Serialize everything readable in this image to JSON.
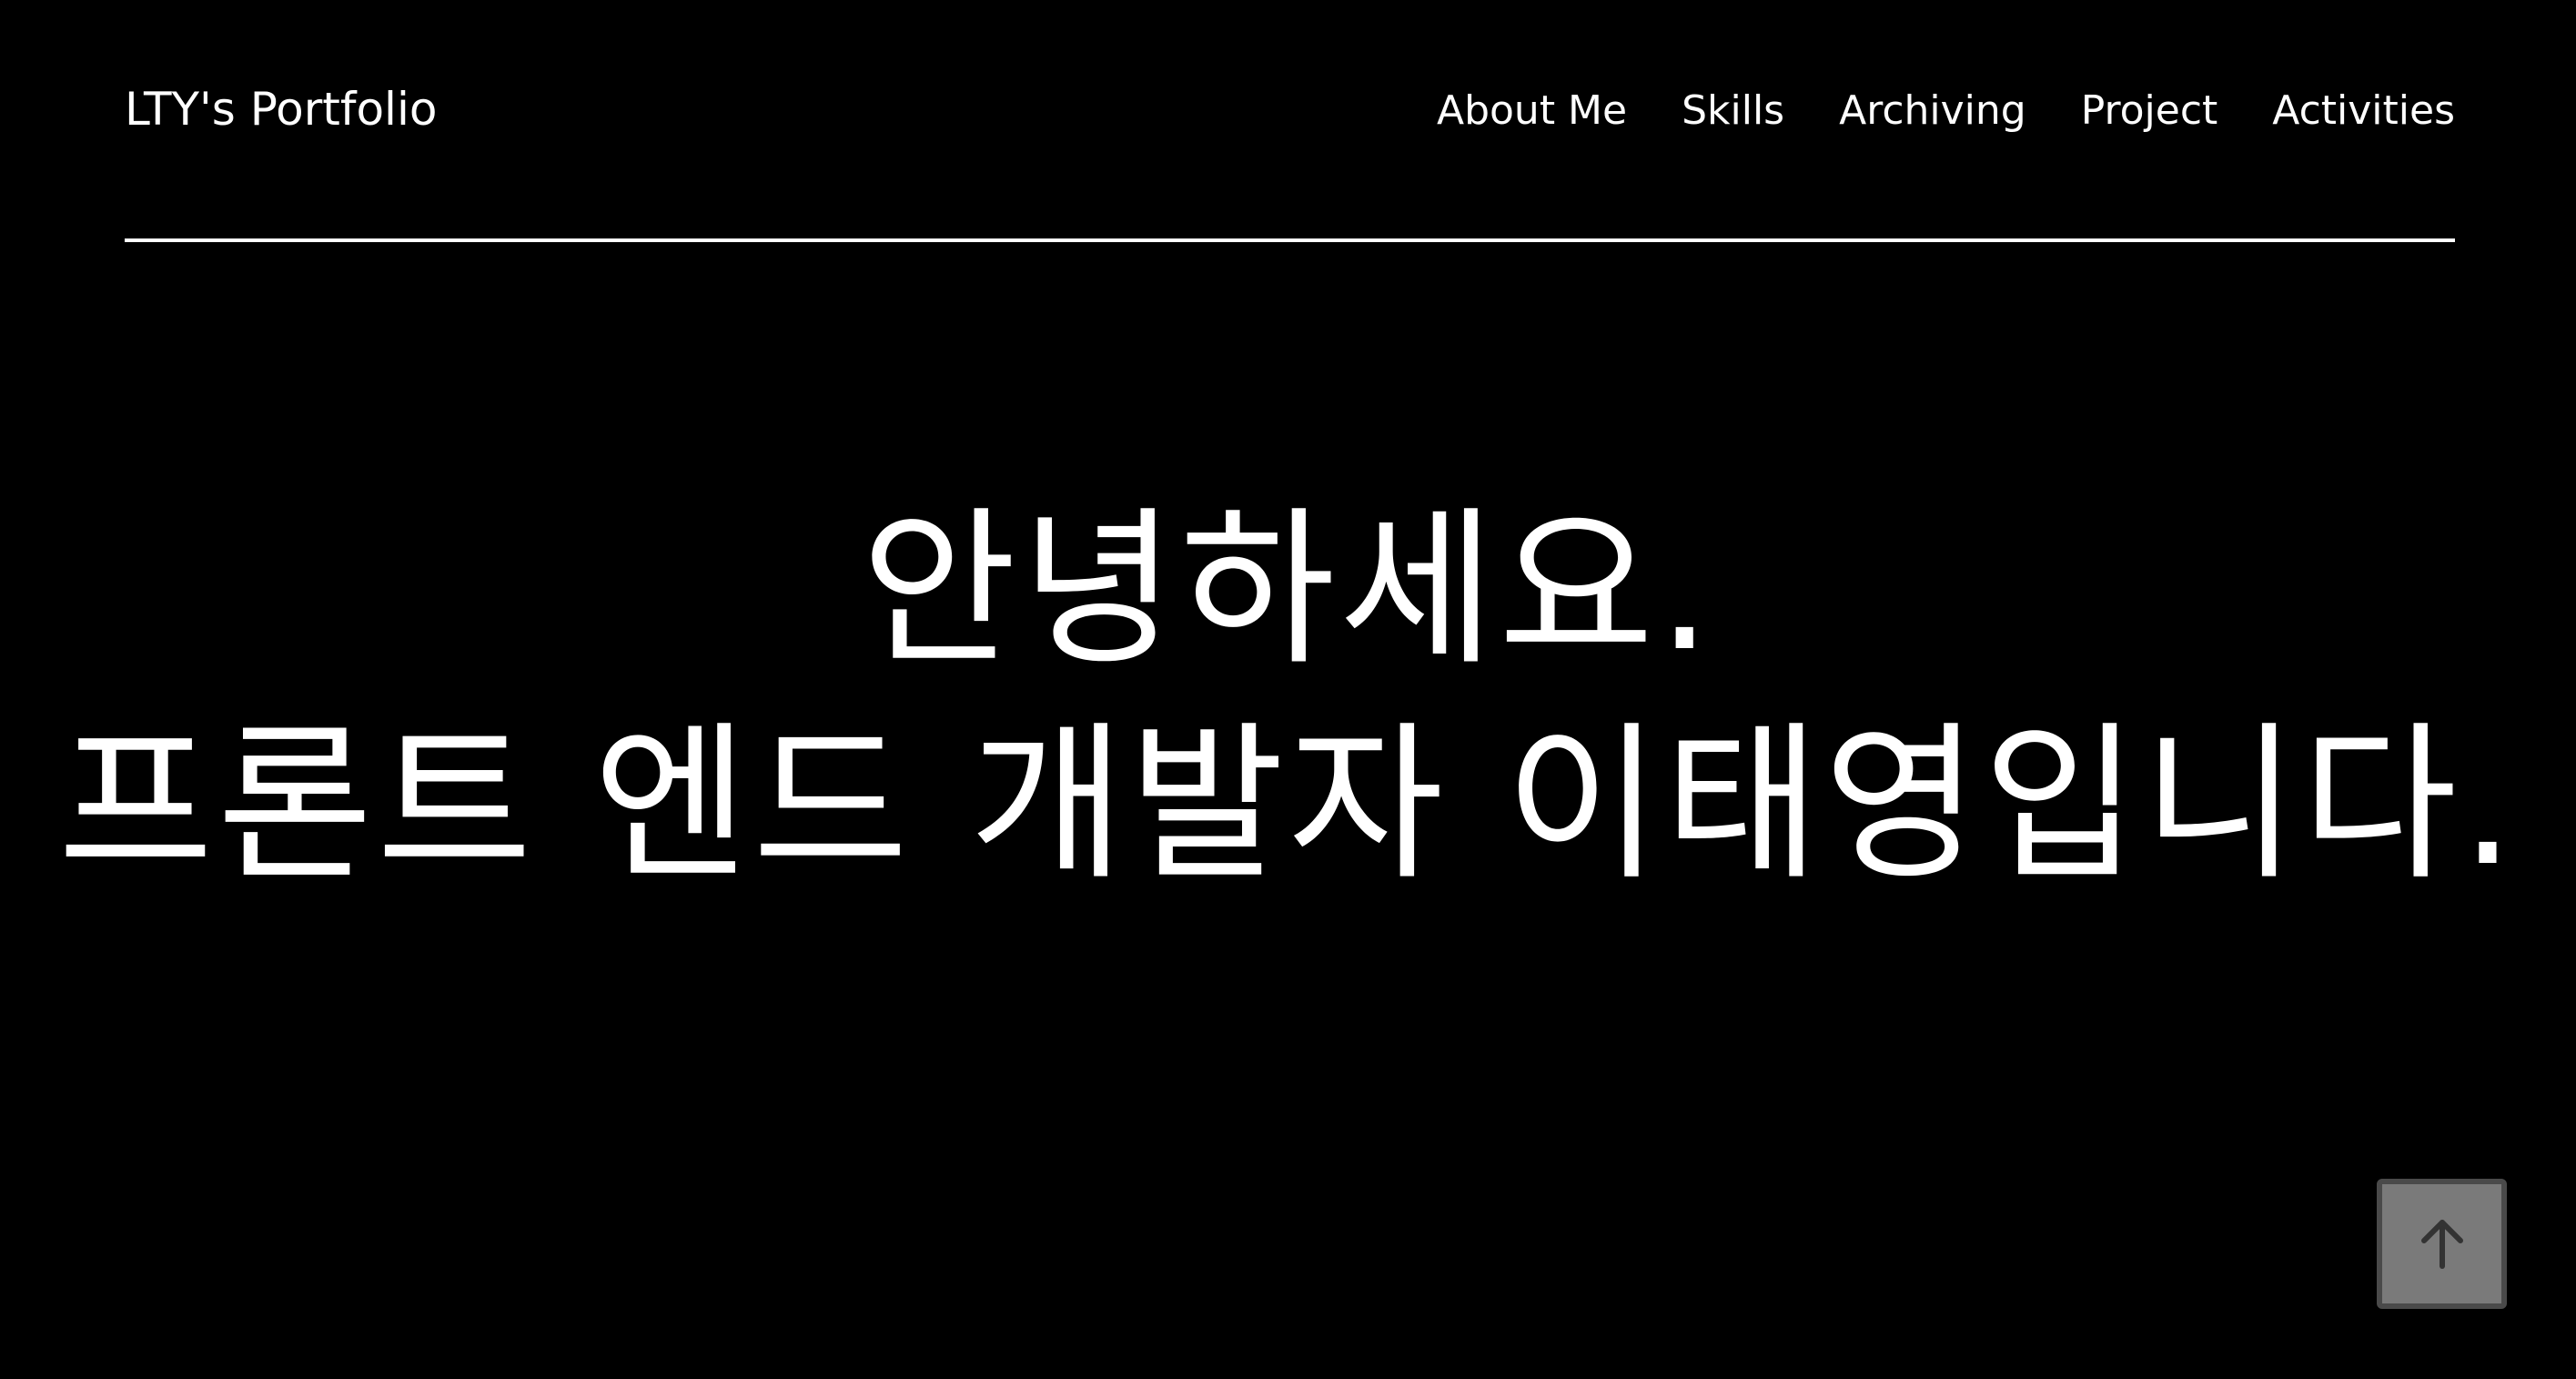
{
  "header": {
    "brand": "LTY's Portfolio",
    "nav": [
      {
        "label": "About Me"
      },
      {
        "label": "Skills"
      },
      {
        "label": "Archiving"
      },
      {
        "label": "Project"
      },
      {
        "label": "Activities"
      }
    ]
  },
  "hero": {
    "line1": "안녕하세요.",
    "line2": "프론트 엔드 개발자 이태영입니다."
  },
  "scroll_top": {
    "icon": "arrow-up-icon"
  },
  "colors": {
    "background": "#000000",
    "text": "#ffffff",
    "button_fill": "#7a7a7a",
    "button_border": "#4a4a4a",
    "arrow": "#333333"
  }
}
